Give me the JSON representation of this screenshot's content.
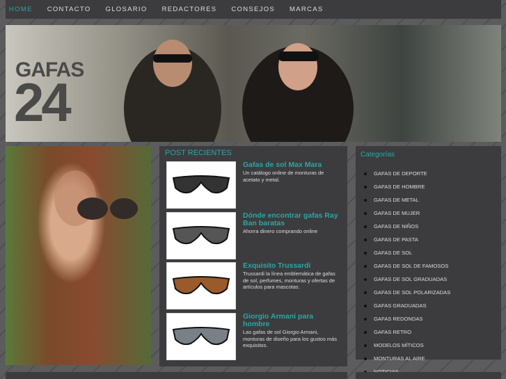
{
  "nav": {
    "items": [
      "HOME",
      "CONTACTO",
      "GLOSARIO",
      "REDACTORES",
      "CONSEJOS",
      "MARCAS"
    ],
    "active": "HOME"
  },
  "banner": {
    "logo_line1": "GAFAS",
    "logo_line2": "24"
  },
  "posts": {
    "heading": "POST RECIENTES",
    "items": [
      {
        "title": "Gafas de sol Max Mara",
        "desc": "Un catálogo online de monturas de acetato y metal.",
        "lens": "#333"
      },
      {
        "title": "Dónde encontrar gafas Ray Ban baratas",
        "desc": "Ahorra dinero comprando online",
        "lens": "#555"
      },
      {
        "title": "Exquisito Trussardi",
        "desc": "Trussardi la línea emblemática de gafas de sol, perfumes, monturas y ofertas de artículos para mascotas.",
        "lens": "#9a5a2a"
      },
      {
        "title": "Giorgio Armani para hombre",
        "desc": "Las gafas de sol Giorgio Armani, monturas de diseño para los gustos más exquisitos.",
        "lens": "#7a8088"
      }
    ]
  },
  "categories": {
    "heading": "Categorías",
    "items": [
      "GAFAS DE DEPORTE",
      "GAFAS DE HOMBRE",
      "GAFAS DE METAL",
      "GAFAS DE MUJER",
      "GAFAS DE NIÑOS",
      "GAFAS DE PASTA",
      "GAFAS DE SOL",
      "GAFAS DE SOL DE FAMOSOS",
      "GAFAS DE SOL GRADUADAS",
      "GAFAS DE SOL POLARIZADAS",
      "GAFAS GRADUADAS",
      "GAFAS REDONDAS",
      "GAFAS RETRO",
      "MODELOS MÍTICOS",
      "MONTURAS AL AIRE",
      "NOTICIAS"
    ]
  }
}
